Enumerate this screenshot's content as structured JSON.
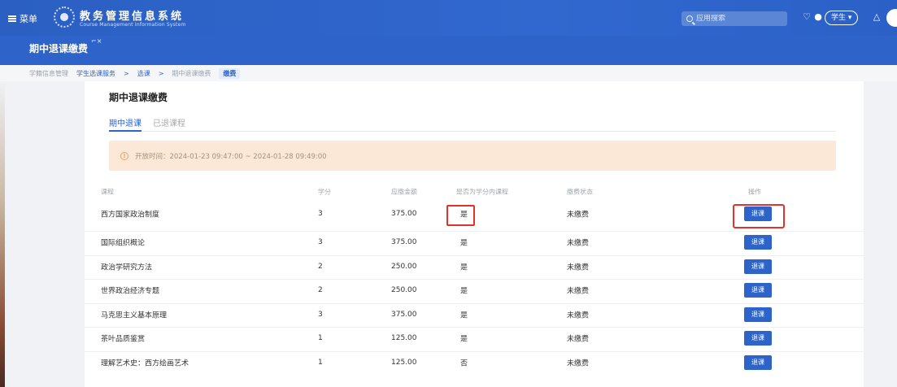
{
  "topbar": {
    "menu_label": "菜单",
    "system_title": "教务管理信息系统",
    "system_subtitle": "Course Management Information System",
    "search_placeholder": "应用搜索",
    "role_label": "学生"
  },
  "page": {
    "tab_label": "期中退课缴费",
    "card_title": "期中退课缴费"
  },
  "breadcrumb": {
    "items": [
      "学籍信息管理",
      "学生选课服务",
      "选课",
      "期中退课缴费",
      "缴费"
    ]
  },
  "tabs": [
    {
      "label": "期中退课",
      "active": true
    },
    {
      "label": "已退课程",
      "active": false
    }
  ],
  "notice": {
    "text": "开放时间：2024-01-23 09:47:00 ~ 2024-01-28 09:49:00"
  },
  "table": {
    "headers": [
      "课程",
      "学分",
      "应缴金额",
      "是否为学分内课程",
      "缴费状态",
      "操作"
    ],
    "rows": [
      {
        "course": "西方国家政治制度",
        "credit": "3",
        "amount": "375.00",
        "in_credit": "是",
        "status": "未缴费",
        "action": "退课"
      },
      {
        "course": "国际组织概论",
        "credit": "3",
        "amount": "375.00",
        "in_credit": "是",
        "status": "未缴费",
        "action": "退课"
      },
      {
        "course": "政治学研究方法",
        "credit": "2",
        "amount": "250.00",
        "in_credit": "是",
        "status": "未缴费",
        "action": "退课"
      },
      {
        "course": "世界政治经济专题",
        "credit": "2",
        "amount": "250.00",
        "in_credit": "是",
        "status": "未缴费",
        "action": "退课"
      },
      {
        "course": "马克思主义基本原理",
        "credit": "3",
        "amount": "375.00",
        "in_credit": "是",
        "status": "未缴费",
        "action": "退课"
      },
      {
        "course": "茶叶品质鉴赏",
        "credit": "1",
        "amount": "125.00",
        "in_credit": "是",
        "status": "未缴费",
        "action": "退课"
      },
      {
        "course": "理解艺术史：西方绘画艺术",
        "credit": "1",
        "amount": "125.00",
        "in_credit": "否",
        "status": "未缴费",
        "action": "退课"
      }
    ]
  },
  "colors": {
    "brand": "#2e64c9",
    "highlight": "#e0332b",
    "notice_bg": "#fbe8d6"
  }
}
